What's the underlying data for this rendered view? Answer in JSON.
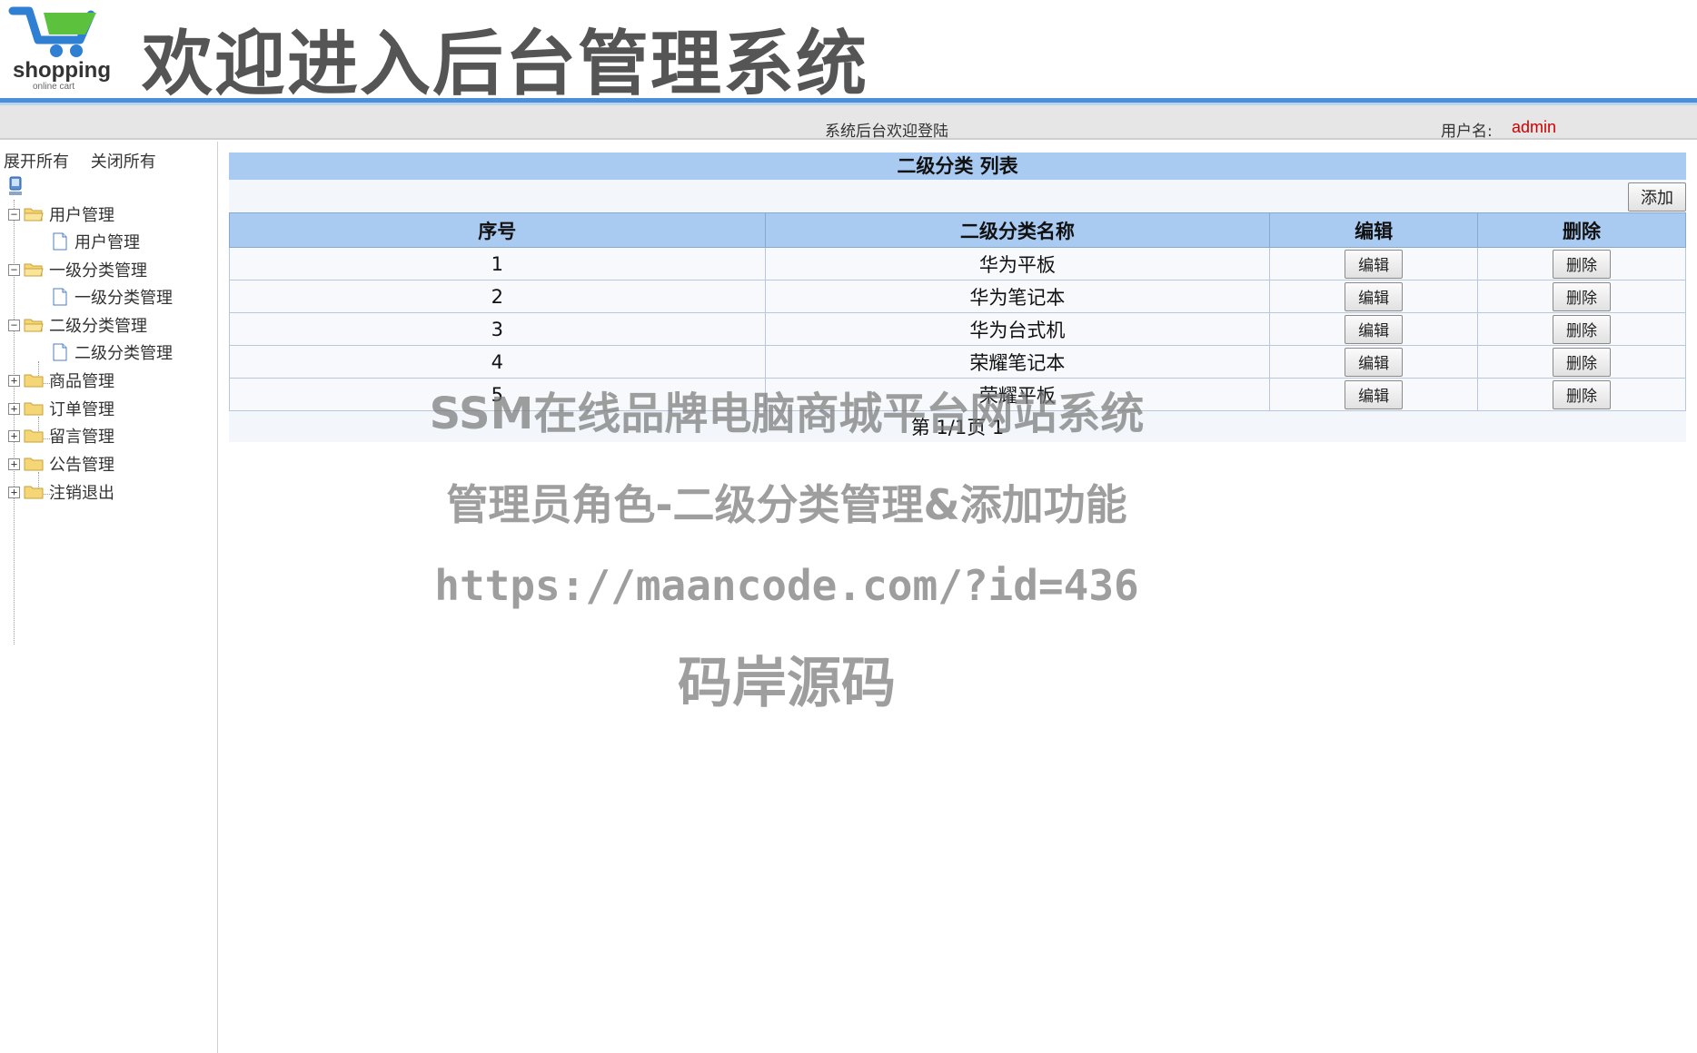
{
  "header": {
    "logo_text": "shopping",
    "logo_sub": "online cart",
    "title": "欢迎进入后台管理系统"
  },
  "status": {
    "welcome": "系统后台欢迎登陆",
    "user_label": "用户名:",
    "username": "admin"
  },
  "sidebar": {
    "expand_all": "展开所有",
    "collapse_all": "关闭所有",
    "groups": [
      {
        "label": "用户管理",
        "expanded": true,
        "child": "用户管理"
      },
      {
        "label": "一级分类管理",
        "expanded": true,
        "child": "一级分类管理"
      },
      {
        "label": "二级分类管理",
        "expanded": true,
        "child": "二级分类管理"
      },
      {
        "label": "商品管理",
        "expanded": false
      },
      {
        "label": "订单管理",
        "expanded": false
      },
      {
        "label": "留言管理",
        "expanded": false
      },
      {
        "label": "公告管理",
        "expanded": false
      },
      {
        "label": "注销退出",
        "expanded": false
      }
    ]
  },
  "main": {
    "title": "二级分类 列表",
    "add_label": "添加",
    "columns": [
      "序号",
      "二级分类名称",
      "编辑",
      "删除"
    ],
    "rows": [
      {
        "id": "1",
        "name": "华为平板"
      },
      {
        "id": "2",
        "name": "华为笔记本"
      },
      {
        "id": "3",
        "name": "华为台式机"
      },
      {
        "id": "4",
        "name": "荣耀笔记本"
      },
      {
        "id": "5",
        "name": "荣耀平板"
      }
    ],
    "edit_label": "编辑",
    "delete_label": "删除",
    "pager": "第 1/1页 1"
  },
  "watermark": {
    "line1": "SSM在线品牌电脑商城平台网站系统",
    "line2": "管理员角色-二级分类管理&添加功能",
    "line3": "https://maancode.com/?id=436",
    "line4": "码岸源码"
  },
  "colors": {
    "accent": "#4a90d9",
    "table_header": "#a9cbf2",
    "username": "#cc0000"
  }
}
